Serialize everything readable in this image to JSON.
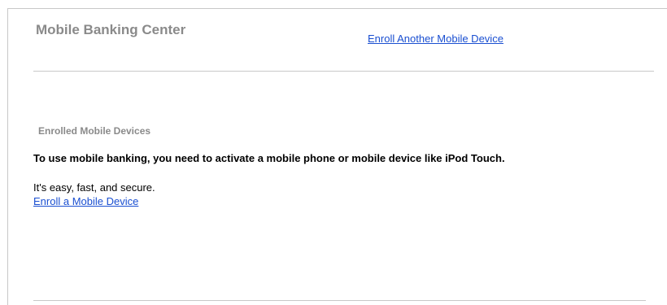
{
  "header": {
    "title": "Mobile Banking Center",
    "enroll_another_link": "Enroll Another Mobile Device"
  },
  "devices": {
    "heading": "Enrolled Mobile Devices",
    "instruction": "To use mobile banking, you need to activate a mobile phone or mobile device like iPod Touch.",
    "tagline": "It's easy, fast, and secure.",
    "enroll_link": "Enroll a Mobile Device"
  },
  "colors": {
    "link": "#1a4fd1",
    "heading_gray": "#8a8a8a",
    "divider": "#c8c8c8"
  }
}
